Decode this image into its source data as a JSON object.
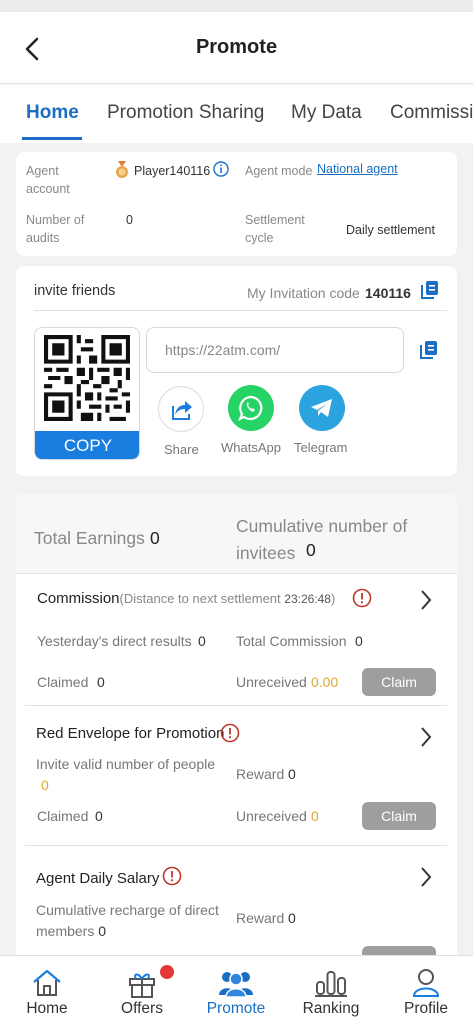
{
  "header": {
    "title": "Promote"
  },
  "tabs": [
    "Home",
    "Promotion Sharing",
    "My Data",
    "Commissi"
  ],
  "agent": {
    "account_label_1": "Agent",
    "account_label_2": "account",
    "account_value": "Player140116",
    "mode_label": "Agent mode",
    "mode_value": "National agent",
    "audits_label_1": "Number of",
    "audits_label_2": "audits",
    "audits_value": "0",
    "cycle_label_1": "Settlement",
    "cycle_label_2": "cycle",
    "cycle_value": "Daily settlement"
  },
  "invite": {
    "title": "invite friends",
    "code_label": "My Invitation code",
    "code_value": "140116",
    "link_placeholder": "https://22atm.com/",
    "copy_label": "COPY",
    "share_label": "Share",
    "whatsapp_label": "WhatsApp",
    "telegram_label": "Telegram"
  },
  "earnings": {
    "total_label": "Total Earnings",
    "total_value": "0",
    "invitees_label_1": "Cumulative number of",
    "invitees_label_2": "invitees",
    "invitees_value": "0"
  },
  "commission": {
    "title": "Commission",
    "subtitle": "(Distance to next settlement ",
    "timer": "23:26:48",
    "subtitle_end": ")",
    "yesterday_label": "Yesterday's direct results",
    "yesterday_value": "0",
    "total_label": "Total Commission",
    "total_value": "0",
    "claimed_label": "Claimed",
    "claimed_value": "0",
    "unreceived_label": "Unreceived",
    "unreceived_value": "0.00",
    "claim_label": "Claim"
  },
  "red_envelope": {
    "title": "Red Envelope for Promotion",
    "invite_label": "Invite valid number of people",
    "invite_value": "0",
    "reward_label": "Reward",
    "reward_value": "0",
    "claimed_label": "Claimed",
    "claimed_value": "0",
    "unreceived_label": "Unreceived",
    "unreceived_value": "0",
    "claim_label": "Claim"
  },
  "salary": {
    "title": "Agent Daily Salary",
    "recharge_label_1": "Cumulative recharge of direct",
    "recharge_label_2": "members",
    "recharge_value": "0",
    "reward_label": "Reward",
    "reward_value": "0"
  },
  "nav": [
    "Home",
    "Offers",
    "Promote",
    "Ranking",
    "Profile"
  ],
  "colors": {
    "accent": "#1a6fc4",
    "whatsapp": "#25d366",
    "telegram": "#2aa3df",
    "alert": "#c0392b",
    "gold": "#e0a82e"
  }
}
